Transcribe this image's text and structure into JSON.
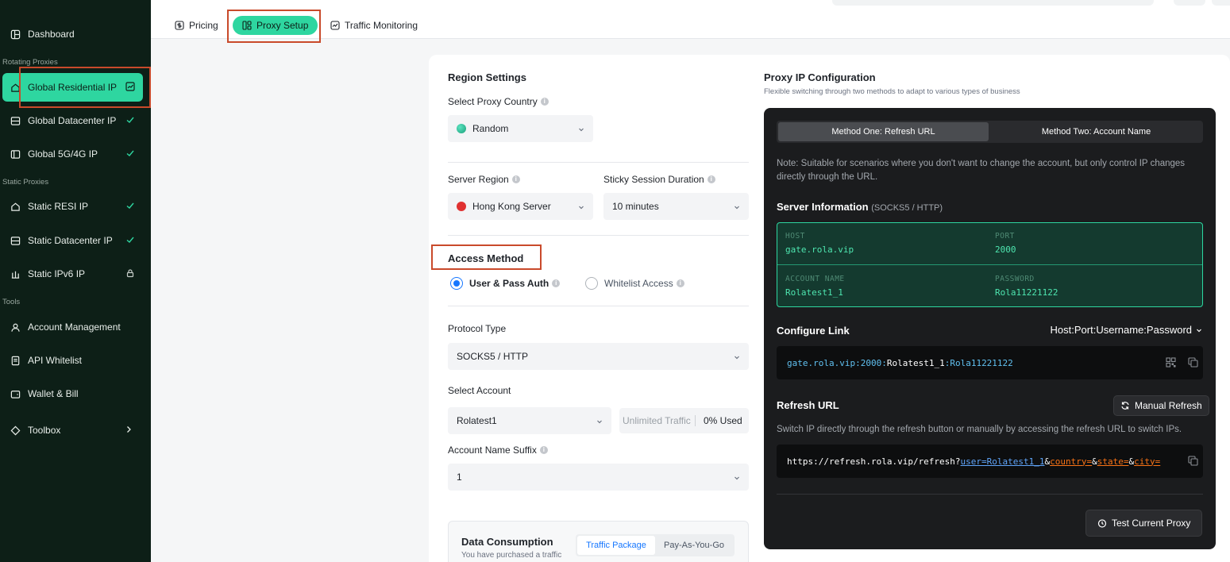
{
  "sidebar": {
    "dashboard": "Dashboard",
    "section_rotating": "Rotating Proxies",
    "global_residential": "Global Residential IP",
    "global_datacenter": "Global Datacenter IP",
    "global_5g4g": "Global 5G/4G IP",
    "section_static": "Static Proxies",
    "static_resi": "Static RESI IP",
    "static_datacenter": "Static Datacenter IP",
    "static_ipv6": "Static IPv6 IP",
    "section_tools": "Tools",
    "account_management": "Account Management",
    "api_whitelist": "API Whitelist",
    "wallet_bill": "Wallet & Bill",
    "toolbox": "Toolbox"
  },
  "tabs": {
    "pricing": "Pricing",
    "proxy_setup": "Proxy Setup",
    "traffic_monitoring": "Traffic Monitoring"
  },
  "region": {
    "title": "Region Settings",
    "country_label": "Select Proxy Country",
    "country_value": "Random",
    "server_region_label": "Server Region",
    "server_region_value": "Hong Kong Server",
    "sticky_label": "Sticky Session Duration",
    "sticky_value": "10 minutes"
  },
  "access": {
    "title": "Access Method",
    "option_userpass": "User & Pass Auth",
    "option_whitelist": "Whitelist Access",
    "selected": "User & Pass Auth"
  },
  "protocol": {
    "label": "Protocol Type",
    "value": "SOCKS5 / HTTP"
  },
  "account": {
    "label": "Select Account",
    "value": "Rolatest1",
    "traffic": "Unlimited Traffic",
    "used": "0% Used",
    "suffix_label": "Account Name Suffix",
    "suffix_value": "1"
  },
  "data_consumption": {
    "title": "Data Consumption",
    "subtitle": "You have purchased a traffic",
    "tab_package": "Traffic Package",
    "tab_payg": "Pay-As-You-Go"
  },
  "config": {
    "title": "Proxy IP Configuration",
    "subtitle": "Flexible switching through two methods to adapt to various types of business",
    "method_one": "Method One: Refresh URL",
    "method_two": "Method Two: Account Name",
    "note": "Note: Suitable for scenarios where you don't want to change the account, but only control IP changes directly through the URL.",
    "server_info_title": "Server Information",
    "server_info_sub": "(SOCKS5 / HTTP)",
    "host_key": "HOST",
    "host_val": "gate.rola.vip",
    "port_key": "PORT",
    "port_val": "2000",
    "account_key": "ACCOUNT NAME",
    "account_val": "Rolatest1_1",
    "password_key": "PASSWORD",
    "password_val": "Rola11221122",
    "configure_link_title": "Configure Link",
    "link_format": "Host:Port:Username:Password",
    "link_part1": "gate.rola.vip:2000:",
    "link_part2": "Rolatest1_1",
    "link_part3": ":",
    "link_part4": "Rola11221122",
    "refresh_title": "Refresh URL",
    "manual_refresh": "Manual Refresh",
    "refresh_desc": "Switch IP directly through the refresh button or manually by accessing the refresh URL to switch IPs.",
    "url_base": "https://refresh.rola.vip/refresh?",
    "url_user": "user=Rolatest1_1",
    "url_amp1": "&",
    "url_country": "country=",
    "url_amp2": "&",
    "url_state": "state=",
    "url_amp3": "&",
    "url_city": "city=",
    "test_proxy": "Test Current Proxy"
  },
  "colors": {
    "accent": "#2ed6a0",
    "sidebar_bg": "#0d1f17",
    "highlight": "#c94a2b",
    "link_blue": "#1677ff"
  }
}
